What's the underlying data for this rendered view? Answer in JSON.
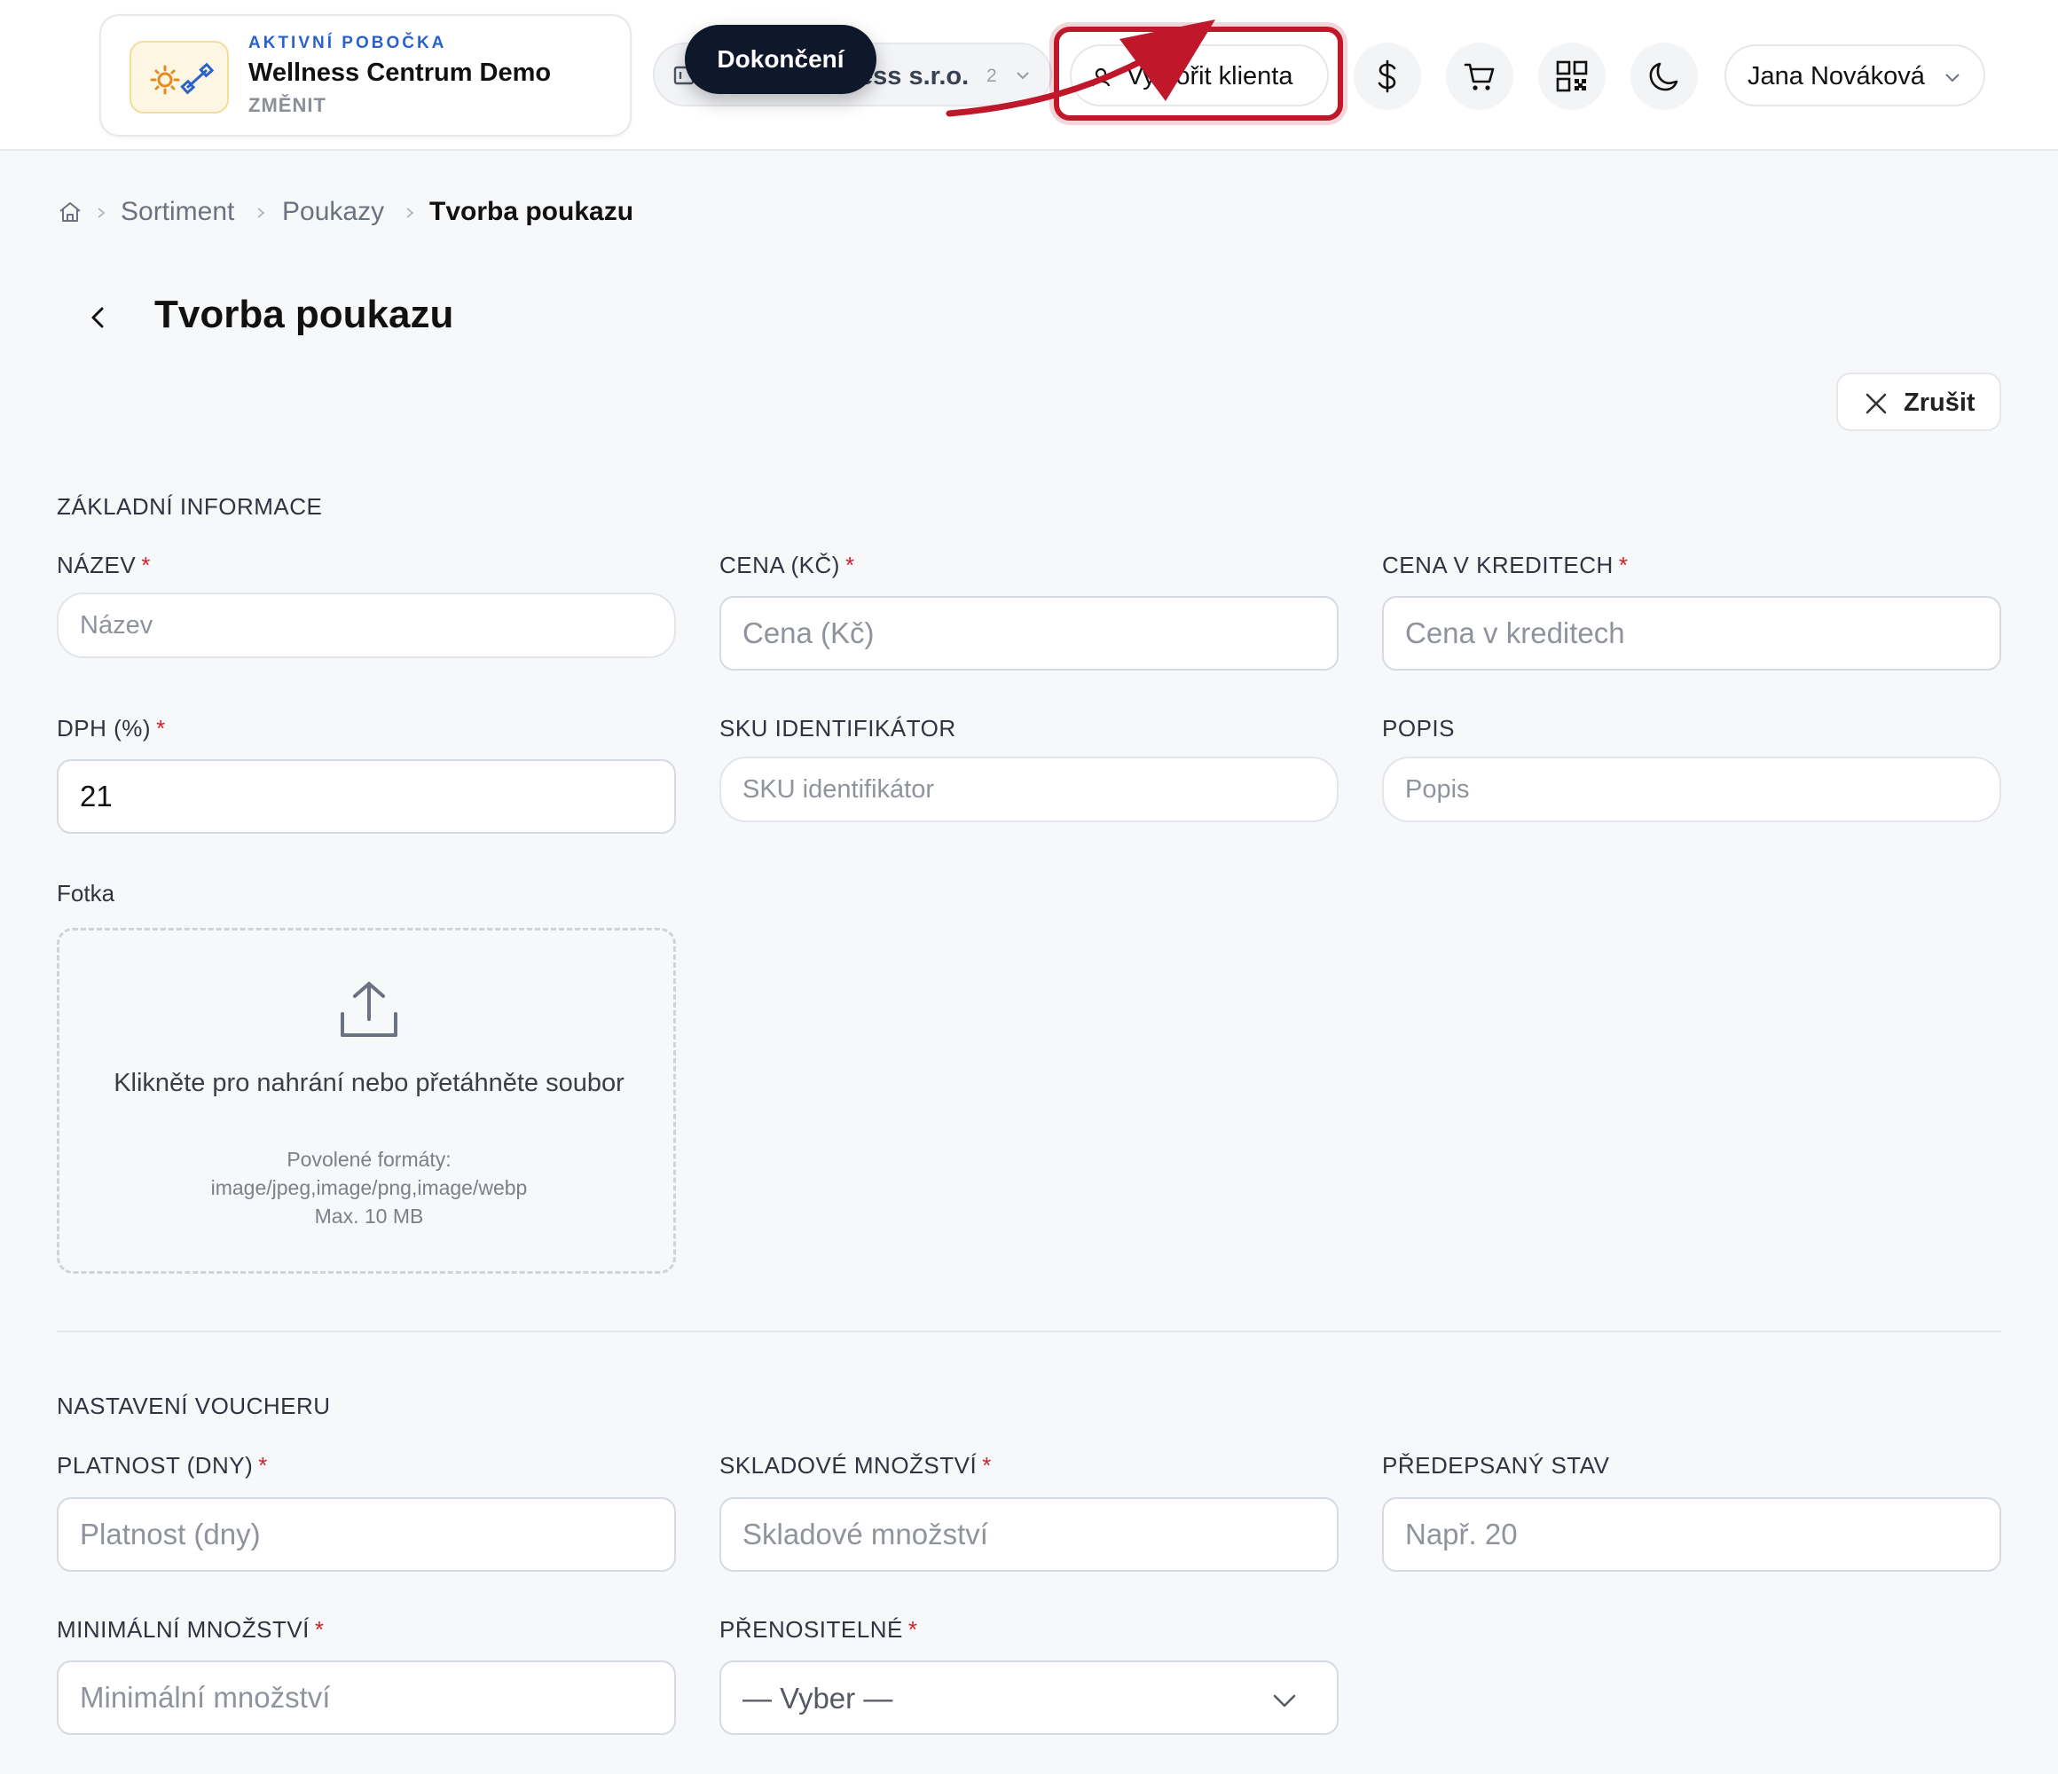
{
  "header": {
    "branch": {
      "kicker": "AKTIVNÍ POBOČKA",
      "name": "Wellness Centrum Demo",
      "change_label": "ZMĚNIT"
    },
    "company_select": {
      "label": "ess s.r.o.",
      "count": "2"
    },
    "tooltip": "Dokončení",
    "create_client_label": "Vytvořit klienta",
    "user_name": "Jana Nováková",
    "icons": [
      "dollar-icon",
      "cart-icon",
      "qr-code-icon",
      "moon-icon"
    ],
    "highlight_color": "#c0172a"
  },
  "breadcrumb": {
    "items": [
      "Sortiment",
      "Poukazy",
      "Tvorba poukazu"
    ]
  },
  "page": {
    "title": "Tvorba poukazu",
    "cancel_label": "Zrušit"
  },
  "basic_info": {
    "section_title": "ZÁKLADNÍ INFORMACE",
    "name": {
      "label": "NÁZEV",
      "required": "*",
      "placeholder": "Název",
      "value": ""
    },
    "price": {
      "label": "CENA (KČ)",
      "required": "*",
      "placeholder": "Cena (Kč)",
      "value": ""
    },
    "credit_price": {
      "label": "CENA V KREDITECH",
      "required": "*",
      "placeholder": "Cena v kreditech",
      "value": ""
    },
    "vat": {
      "label": "DPH (%)",
      "required": "*",
      "placeholder": "",
      "value": "21"
    },
    "sku": {
      "label": "SKU IDENTIFIKÁTOR",
      "placeholder": "SKU identifikátor",
      "value": ""
    },
    "description": {
      "label": "POPIS",
      "placeholder": "Popis",
      "value": ""
    },
    "photo": {
      "label": "Fotka",
      "main_text": "Klikněte pro nahrání nebo přetáhněte soubor",
      "formats_label": "Povolené formáty:",
      "formats": "image/jpeg,image/png,image/webp",
      "max_size": "Max. 10 MB"
    }
  },
  "voucher_settings": {
    "section_title": "NASTAVENÍ VOUCHERU",
    "validity": {
      "label": "PLATNOST (DNY)",
      "required": "*",
      "placeholder": "Platnost (dny)",
      "value": ""
    },
    "stock": {
      "label": "SKLADOVÉ MNOŽSTVÍ",
      "required": "*",
      "placeholder": "Skladové množství",
      "value": ""
    },
    "prescribed_state": {
      "label": "PŘEDEPSANÝ STAV",
      "placeholder": "Např. 20",
      "value": ""
    },
    "min_quantity": {
      "label": "MINIMÁLNÍ MNOŽSTVÍ",
      "required": "*",
      "placeholder": "Minimální množství",
      "value": ""
    },
    "transferable": {
      "label": "PŘENOSITELNÉ",
      "required": "*",
      "selected": "— Vyber —"
    }
  }
}
